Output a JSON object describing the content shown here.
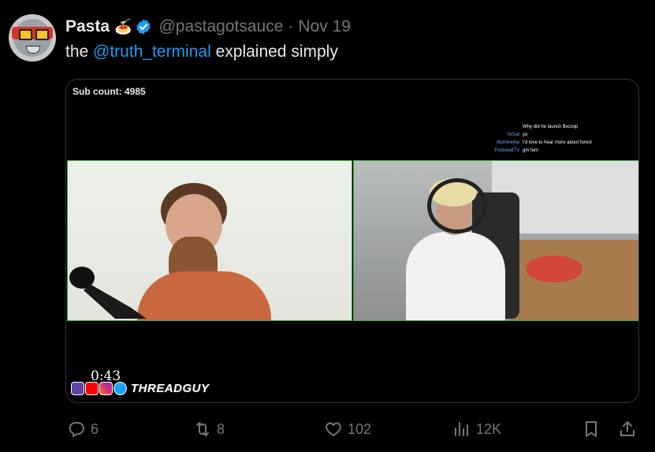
{
  "tweet": {
    "author_name": "Pasta",
    "author_emoji": "🍝",
    "handle": "@pastagotsauce",
    "separator": "·",
    "date": "Nov 19",
    "text_before": "the ",
    "mention": "@truth_terminal",
    "text_after": " explained simply"
  },
  "media": {
    "sub_count": "Sub count: 4985",
    "chat": [
      {
        "user": "",
        "message": "Why did he launch $scoop"
      },
      {
        "user": "0xSat",
        "message": "yo"
      },
      {
        "user": "Illuminertia",
        "message": "I'd love to hear more about forest"
      },
      {
        "user": "FridewallTV",
        "message": "gm fam"
      }
    ],
    "timestamp": "0:43",
    "brand_text": "THREADGUY"
  },
  "actions": {
    "replies": "6",
    "reposts": "8",
    "likes": "102",
    "views": "12K"
  },
  "colors": {
    "background": "#000000",
    "text": "#e7e9ea",
    "muted": "#71767b",
    "accent": "#1d9bf0",
    "camera_border": "#3aa83a"
  },
  "icons": [
    "verified-badge-icon",
    "reply-icon",
    "repost-icon",
    "like-icon",
    "views-icon",
    "bookmark-icon",
    "share-icon"
  ]
}
